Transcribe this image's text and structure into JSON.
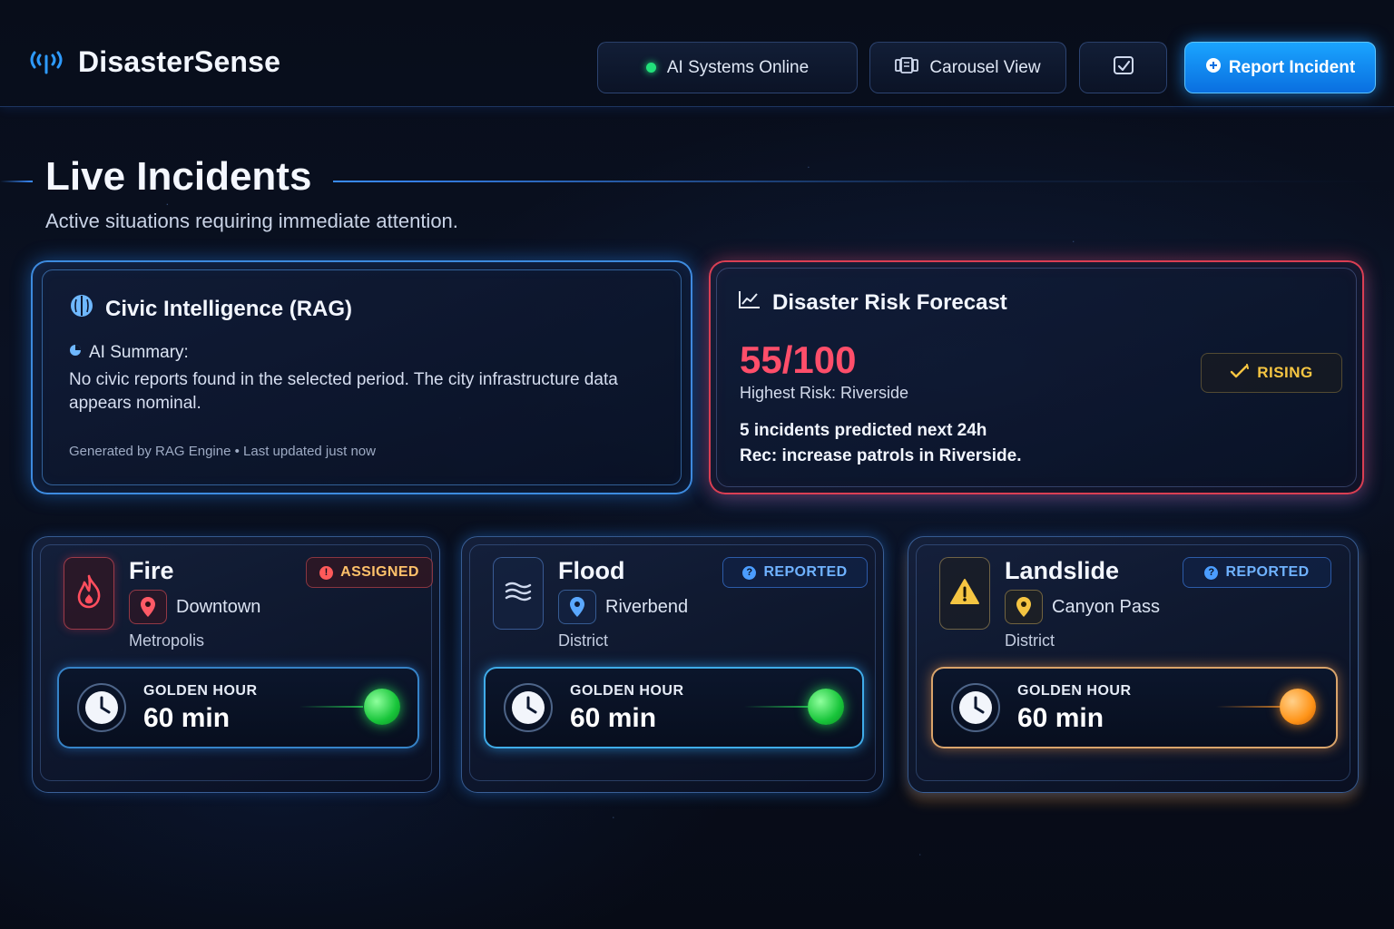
{
  "header": {
    "brand_name": "DisasterSense",
    "status_label": "AI Systems Online",
    "carousel_label": "Carousel View",
    "report_label": "Report Incident"
  },
  "page": {
    "title": "Live Incidents",
    "subtitle": "Active situations requiring immediate attention."
  },
  "rag": {
    "title": "Civic Intelligence (RAG)",
    "summary_label": "AI Summary:",
    "summary_text": "No civic reports found in the selected period. The city infrastructure data appears nominal.",
    "footer": "Generated by RAG Engine  •  Last updated just now"
  },
  "forecast": {
    "title": "Disaster Risk Forecast",
    "score": "55/100",
    "highest_risk": "Highest Risk: Riverside",
    "trend": "RISING",
    "predicted": "5 incidents predicted next 24h",
    "recommendation": "Rec: increase patrols in Riverside."
  },
  "incidents": [
    {
      "type": "Fire",
      "icon": "flame-icon",
      "location_line1": "Downtown",
      "location_line2": "Metropolis",
      "status": "ASSIGNED",
      "golden_label": "GOLDEN HOUR",
      "golden_value": "60 min",
      "urgency_color": "#22e05a"
    },
    {
      "type": "Flood",
      "icon": "wave-icon",
      "location_line1": "Riverbend",
      "location_line2": "District",
      "status": "REPORTED",
      "golden_label": "GOLDEN HOUR",
      "golden_value": "60 min",
      "urgency_color": "#22e05a"
    },
    {
      "type": "Landslide",
      "icon": "warning-icon",
      "location_line1": "Canyon Pass",
      "location_line2": "District",
      "status": "REPORTED",
      "golden_label": "GOLDEN HOUR",
      "golden_value": "60 min",
      "urgency_color": "#ff9418"
    }
  ],
  "colors": {
    "accent": "#1aa4ff",
    "risk": "#ff4e6a",
    "rising": "#f5c542",
    "online": "#22e07a"
  }
}
